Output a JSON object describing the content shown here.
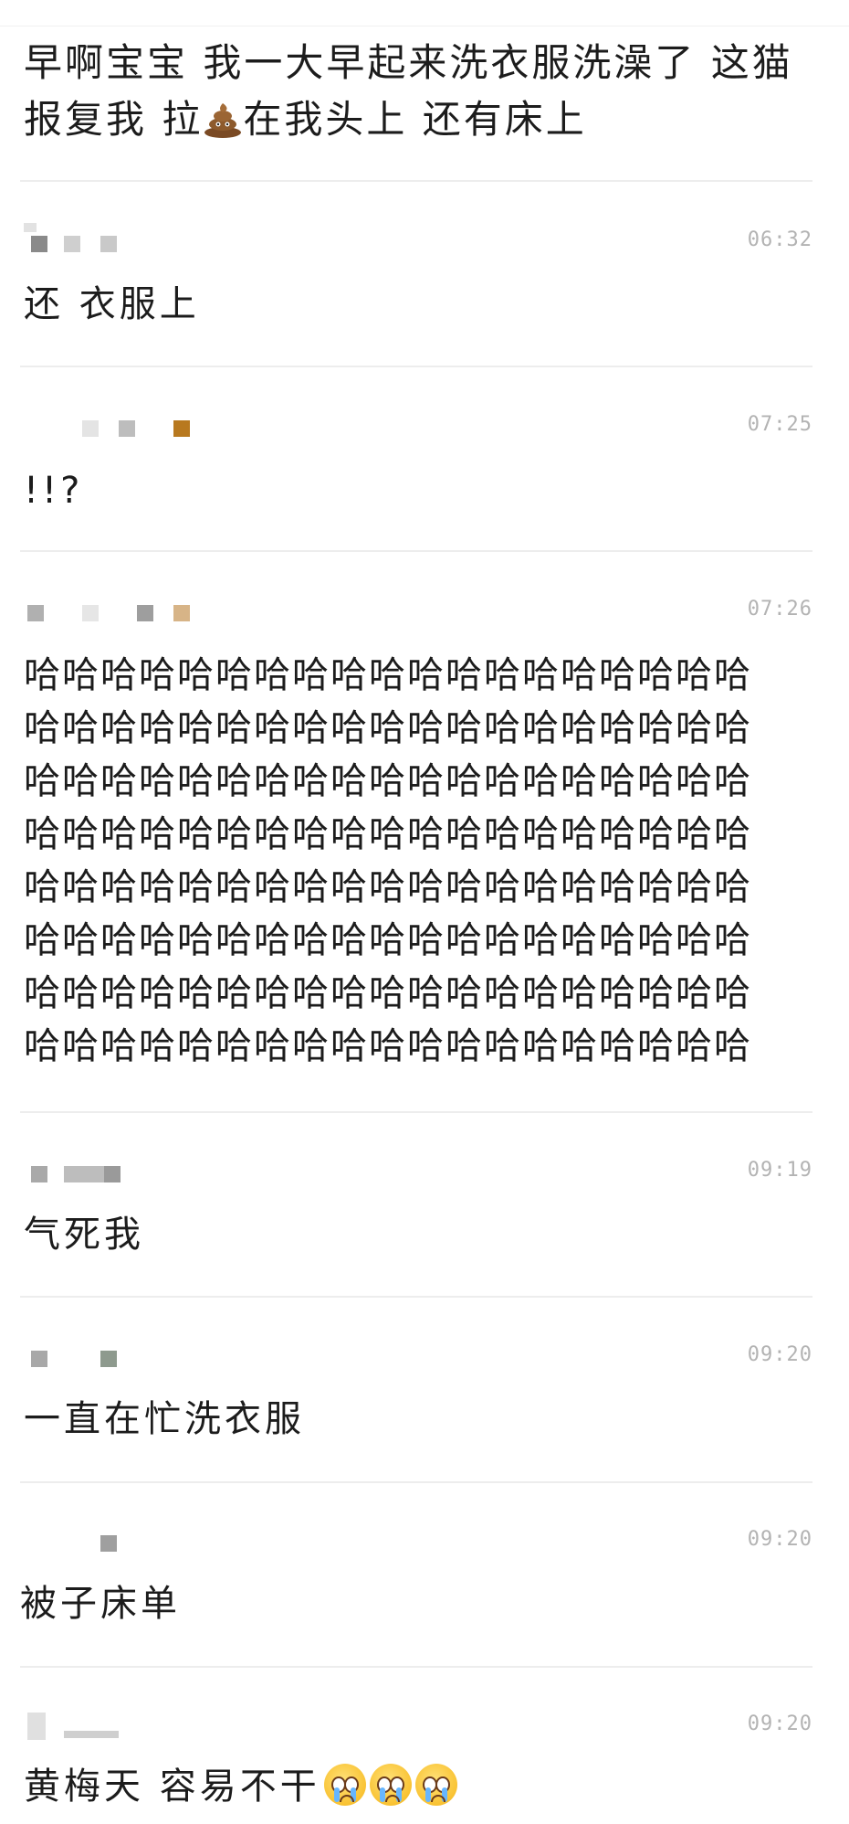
{
  "post": {
    "text_part1": "早啊宝宝 我一大早起来洗衣服洗澡了 这猫报复我 拉",
    "emoji": "poop-emoji",
    "text_part2": "在我头上 还有床上"
  },
  "comments": [
    {
      "time": "06:32",
      "text": "还 衣服上",
      "avatar_colors": [
        "#8a8a8a",
        "#cfcfcf",
        "#c9c9c9"
      ]
    },
    {
      "time": "07:25",
      "text": "!!?",
      "avatar_colors": [
        "#e4e4e4",
        "#bdbdbd",
        "#b8791f"
      ]
    },
    {
      "time": "07:26",
      "text": "哈哈哈哈哈哈哈哈哈哈哈哈哈哈哈哈哈哈哈哈哈哈哈哈哈哈哈哈哈哈哈哈哈哈哈哈哈哈哈哈哈哈哈哈哈哈哈哈哈哈哈哈哈哈哈哈哈哈哈哈哈哈哈哈哈哈哈哈哈哈哈哈哈哈哈哈哈哈哈哈哈哈哈哈哈哈哈哈哈哈哈哈哈哈哈哈哈哈哈哈哈哈哈哈哈哈哈哈哈哈哈哈哈哈哈哈哈哈哈哈哈哈哈哈哈哈哈哈哈哈哈哈哈哈哈哈哈哈哈哈哈哈哈哈哈哈哈哈哈哈哈哈",
      "avatar_colors": [
        "#b0b0b0",
        "#e6e6e6",
        "#9e9e9e",
        "#d7b487"
      ]
    },
    {
      "time": "09:19",
      "text": "气死我",
      "avatar_colors": [
        "#a9a9a9",
        "#bdbdbd",
        "#9a9a9a"
      ]
    },
    {
      "time": "09:20",
      "text": "一直在忙洗衣服",
      "avatar_colors": [
        "#a8a8a8",
        "#8e9a8e"
      ]
    },
    {
      "time": "09:20",
      "text": "被子床单",
      "avatar_colors": [
        "#9f9f9f"
      ]
    },
    {
      "time": "09:20",
      "text": "黄梅天 容易不干",
      "emoji": "crying-face-emoji",
      "emoji_count": 3,
      "avatar_colors": [
        "#e0e0e0",
        "#cfcfcf"
      ]
    }
  ]
}
